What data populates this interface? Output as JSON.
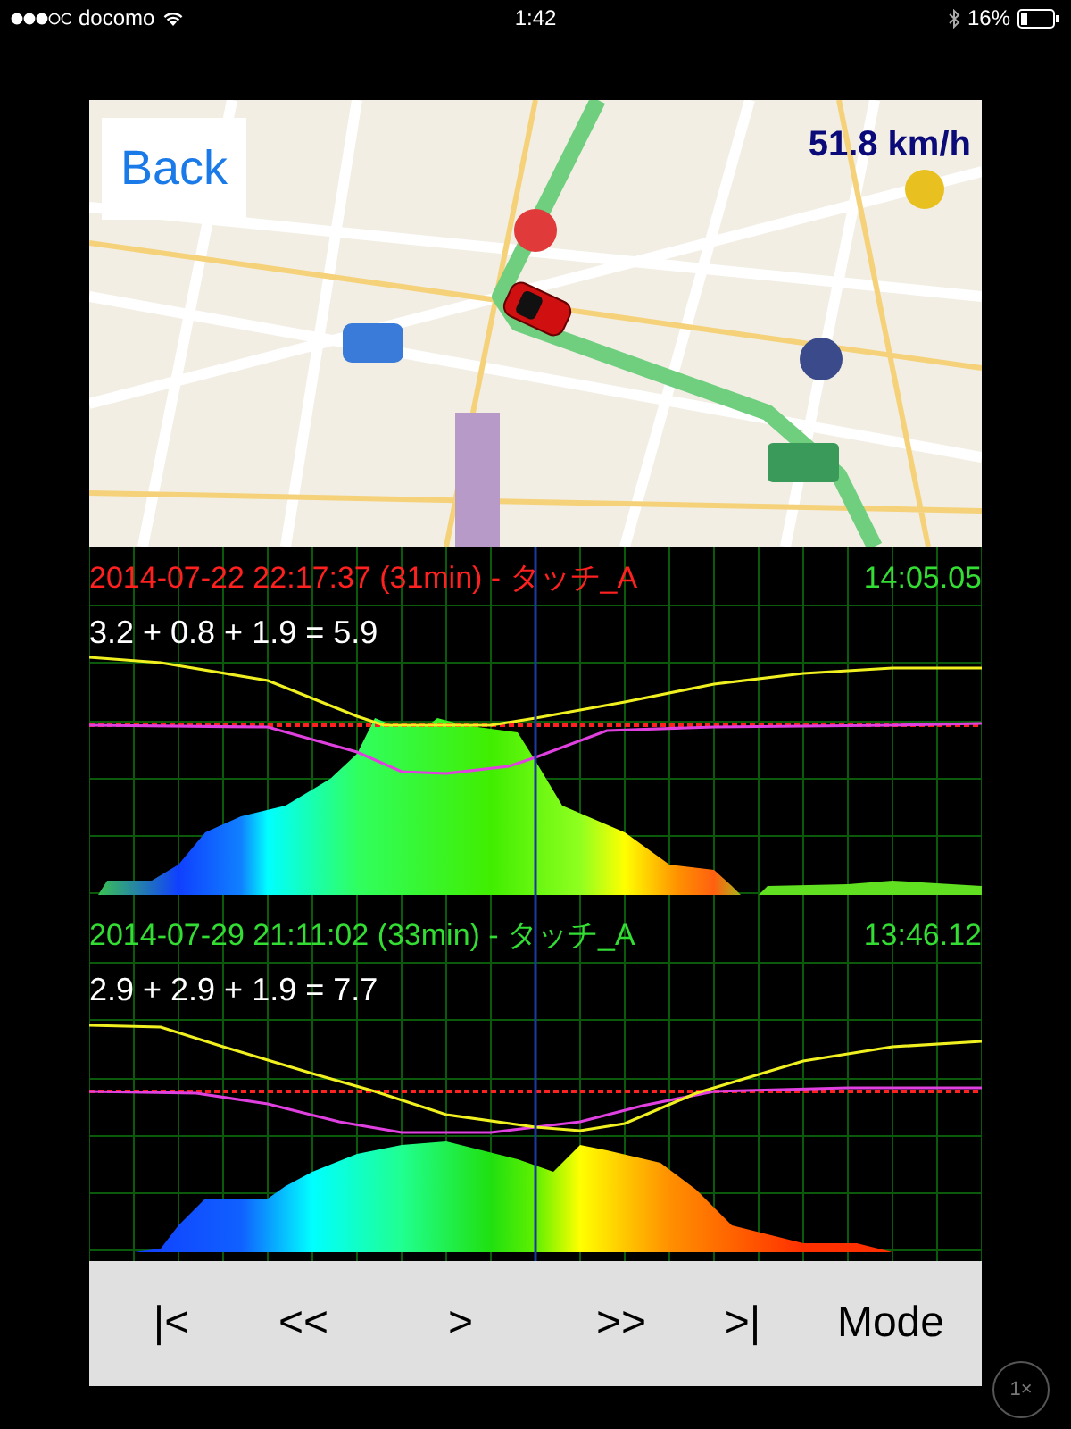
{
  "status_bar": {
    "carrier": "docomo",
    "time": "1:42",
    "battery": "16%"
  },
  "map": {
    "kind": "picture",
    "back_button": "Back",
    "speed": "51.8 km/h"
  },
  "runs": [
    {
      "title": "2014-07-22 22:17:37 (31min) - タッチ_A",
      "color": "#ff2020",
      "time": "14:05.05",
      "formula": "3.2 + 0.8 + 1.9 = 5.9"
    },
    {
      "title": "2014-07-29 21:11:02 (33min) - タッチ_A",
      "color": "#33dd33",
      "time": "13:46.12",
      "formula": "2.9 + 2.9 + 1.9 = 7.7"
    }
  ],
  "controls": [
    "|<",
    "<<",
    ">",
    ">>",
    ">|",
    "Mode"
  ],
  "zoom_button": "1×"
}
